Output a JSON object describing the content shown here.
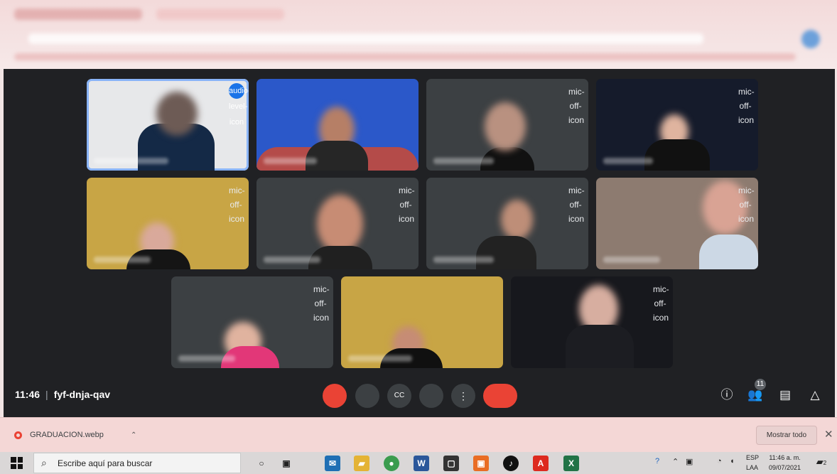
{
  "meeting": {
    "time": "11:46",
    "code": "fyf-dnja-qav",
    "participant_count": "11"
  },
  "tiles": {
    "speaking_icon": "audio-level-icon",
    "muted_icon": "mic-off-icon"
  },
  "controls": {
    "mic": "mic-off-icon",
    "camera": "camera-icon",
    "captions": "CC",
    "present": "present-icon",
    "more": "⋮",
    "leave": "phone-hangup-icon"
  },
  "right_icons": [
    "info-icon",
    "people-icon",
    "chat-icon",
    "activities-icon"
  ],
  "download_bar": {
    "file_name": "GRADUACION.webp",
    "show_all": "Mostrar todo",
    "close": "✕"
  },
  "taskbar": {
    "search_placeholder": "Escribe aquí para buscar",
    "language_top": "ESP",
    "language_bottom": "LAA",
    "clock_time": "11:46 a. m.",
    "clock_date": "09/07/2021",
    "notification_count": "2"
  },
  "colors": {
    "meet_bg": "#202124",
    "tile_bg": "#3c4043",
    "red": "#ea4335",
    "blue": "#1a73e8"
  }
}
